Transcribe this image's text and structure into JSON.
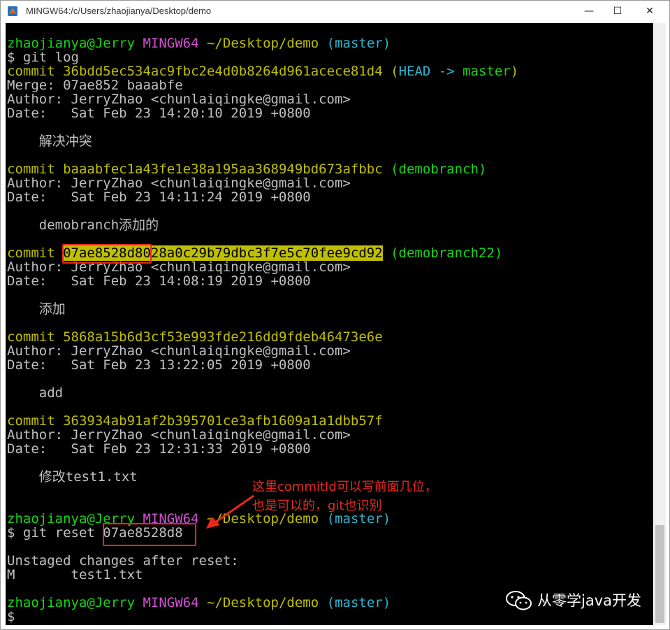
{
  "window": {
    "title": "MINGW64:/c/Users/zhaojianya/Desktop/demo",
    "min_glyph": "—",
    "max_glyph": "☐",
    "close_glyph": "✕"
  },
  "terminal": {
    "prompt1": {
      "user": "zhaojianya@Jerry",
      "shell": "MINGW64",
      "path": "~/Desktop/demo",
      "branch": "(master)"
    },
    "cmd1": "$ git log",
    "commits": [
      {
        "label": "commit",
        "hash": "36bdd5ec534ac9fbc2e4d0b8264d961acece81d4",
        "refs_open": "(",
        "refs_head": "HEAD -> ",
        "refs_name": "master",
        "refs_close": ")",
        "merge": "Merge: 07ae852 baaabfe",
        "author": "Author: JerryZhao <chunlaiqingke@gmail.com>",
        "date": "Date:   Sat Feb 23 14:20:10 2019 +0800",
        "message": "    解决冲突"
      },
      {
        "label": "commit",
        "hash": "baaabfec1a43fe1e38a195aa368949bd673afbbc",
        "refs": "(demobranch)",
        "author": "Author: JerryZhao <chunlaiqingke@gmail.com>",
        "date": "Date:   Sat Feb 23 14:11:24 2019 +0800",
        "message": "    demobranch添加的"
      },
      {
        "label": "commit",
        "hash_prefix": "07ae8528d8",
        "hash_rest": "028a0c29b79dbc3f7e5c70fee9cd92",
        "refs": "(demobranch22)",
        "author": "Author: JerryZhao <chunlaiqingke@gmail.com>",
        "date": "Date:   Sat Feb 23 14:08:19 2019 +0800",
        "message": "    添加"
      },
      {
        "label": "commit",
        "hash": "5868a15b6d3cf53e993fde216dd9fdeb46473e6e",
        "author": "Author: JerryZhao <chunlaiqingke@gmail.com>",
        "date": "Date:   Sat Feb 23 13:22:05 2019 +0800",
        "message": "    add"
      },
      {
        "label": "commit",
        "hash": "363934ab91af2b395701ce3afb1609a1a1dbb57f",
        "author": "Author: JerryZhao <chunlaiqingke@gmail.com>",
        "date": "Date:   Sat Feb 23 12:31:33 2019 +0800",
        "message": "    修改test1.txt"
      }
    ],
    "prompt2": {
      "user": "zhaojianya@Jerry",
      "shell": "MINGW64",
      "path": "~/Desktop/demo",
      "branch": "(master)"
    },
    "cmd2_prefix": "$ git reset ",
    "cmd2_arg": "07ae8528d8",
    "unstaged": "Unstaged changes after reset:",
    "modified": "M       test1.txt",
    "prompt3": {
      "user": "zhaojianya@Jerry",
      "shell": "MINGW64",
      "path": "~/Desktop/demo",
      "branch": "(master)"
    },
    "cursor_prompt": "$"
  },
  "annotation": {
    "line1": "这里commitId可以写前面几位，",
    "line2": "也是可以的，git也识别",
    "color": "#e8281e"
  },
  "watermark": {
    "text": "从零学java开发"
  },
  "colors": {
    "green": "#14d714",
    "magenta": "#d24fd2",
    "yellow": "#bfbf00",
    "cyan": "#2ab7d1",
    "text": "#c0c0c0",
    "background": "#000000"
  }
}
